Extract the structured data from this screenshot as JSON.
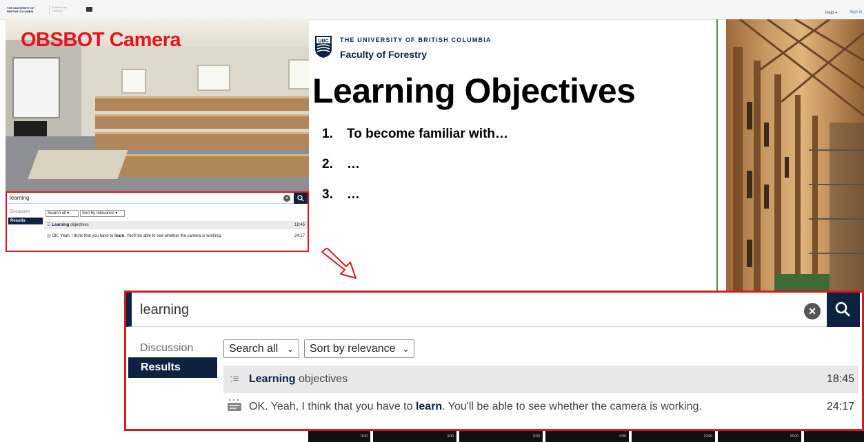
{
  "topbar": {
    "logo_text": "THE UNIVERSITY OF BRITISH COLUMBIA",
    "powered_by": "Powered by Panopto",
    "help_label": "Help ▾",
    "signin_label": "Sign in"
  },
  "camera": {
    "overlay_title": "OBSBOT Camera"
  },
  "small_search": {
    "query": "learning",
    "tabs": [
      "Discussion",
      "Results"
    ],
    "filter_scope": "Search all",
    "filter_sort": "Sort by relevance",
    "results": [
      {
        "pre": "",
        "keyword": "Learning",
        "post": " objectives",
        "time": "18:45"
      },
      {
        "pre": "OK. Yeah, I think that you have to ",
        "keyword": "learn",
        "post": ". You'll be able to see whether the camera is working.",
        "time": "24:17"
      }
    ]
  },
  "slide": {
    "university": "THE UNIVERSITY OF BRITISH COLUMBIA",
    "faculty": "Faculty of Forestry",
    "crest_label": "UBC",
    "title": "Learning Objectives",
    "objectives": [
      {
        "num": "1.",
        "text": "To become familiar with…"
      },
      {
        "num": "2.",
        "text": "…"
      },
      {
        "num": "3.",
        "text": "…"
      }
    ]
  },
  "zoom_search": {
    "query": "learning",
    "tab_discussion": "Discussion",
    "tab_results": "Results",
    "filter_scope": "Search all",
    "filter_sort": "Sort by relevance",
    "results": [
      {
        "icon": "slide-list-icon",
        "pre": "",
        "keyword": "Learning",
        "post": " objectives",
        "time": "18:45"
      },
      {
        "icon": "caption-icon",
        "pre": "OK. Yeah, I think that you have to ",
        "keyword": "learn",
        "post": ". You'll be able to see whether the camera is working.",
        "time": "24:17"
      }
    ]
  },
  "timeline": {
    "marks": [
      "0:00",
      "3:00",
      "6:00",
      "9:00",
      "12:00",
      "15:00"
    ]
  },
  "colors": {
    "ubc_navy": "#0d2240",
    "highlight_red": "#d71920"
  }
}
